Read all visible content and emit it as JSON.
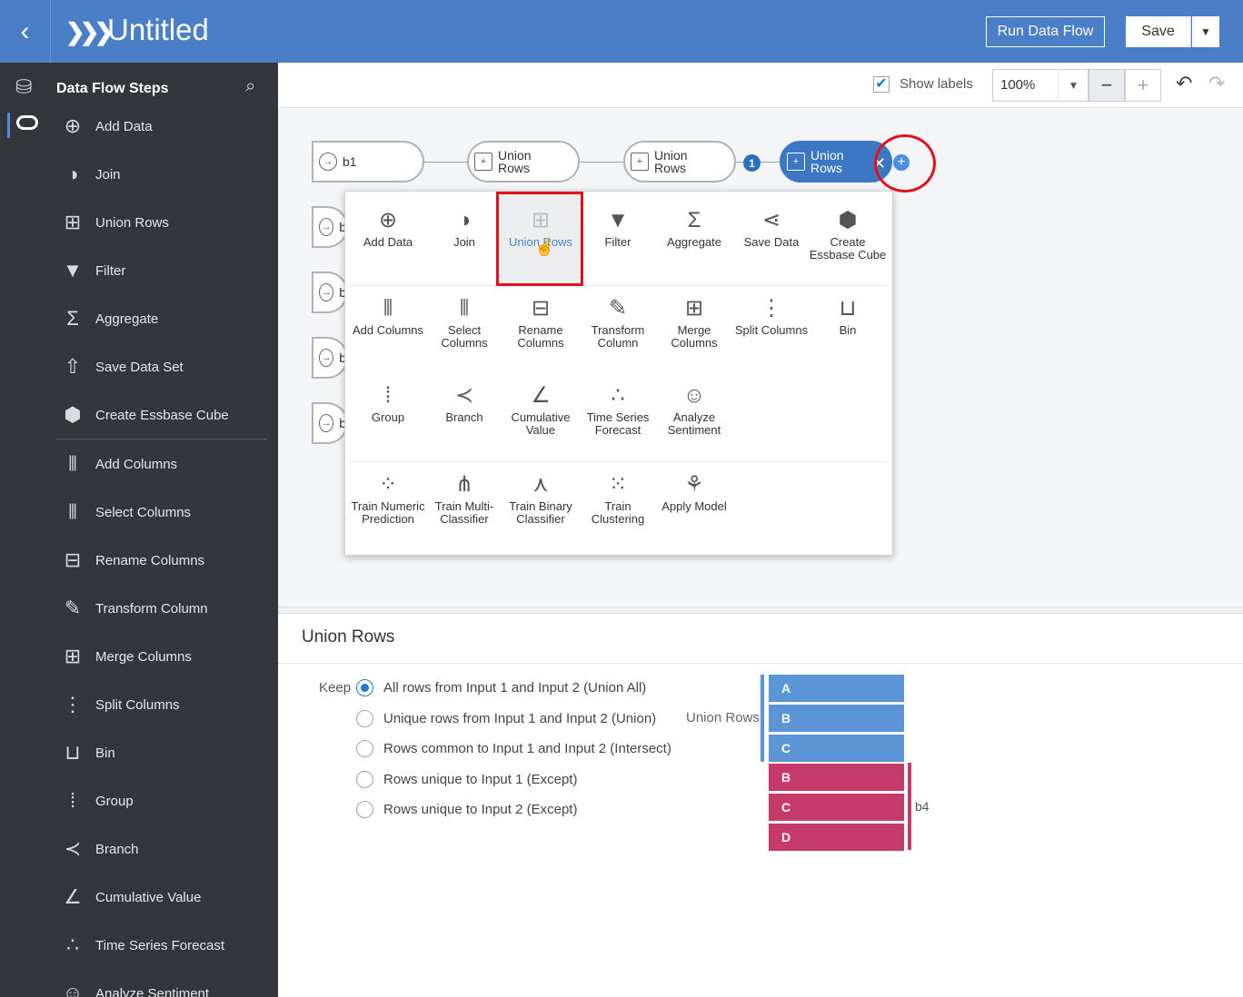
{
  "header": {
    "title": "Untitled",
    "run_label": "Run Data Flow",
    "save_label": "Save"
  },
  "sidebar": {
    "title": "Data Flow Steps",
    "items": [
      {
        "label": "Add Data",
        "icon": "add-data-icon",
        "glyph": "⊕"
      },
      {
        "label": "Join",
        "icon": "join-icon",
        "glyph": "◑"
      },
      {
        "label": "Union Rows",
        "icon": "union-rows-icon",
        "glyph": "⊞"
      },
      {
        "label": "Filter",
        "icon": "filter-icon",
        "glyph": "▼"
      },
      {
        "label": "Aggregate",
        "icon": "aggregate-icon",
        "glyph": "Σ"
      },
      {
        "label": "Save Data Set",
        "icon": "save-data-set-icon",
        "glyph": "⇧"
      },
      {
        "label": "Create Essbase Cube",
        "icon": "cube-icon",
        "glyph": "⬢"
      },
      {
        "label": "Add Columns",
        "icon": "add-columns-icon",
        "glyph": "⫴"
      },
      {
        "label": "Select Columns",
        "icon": "select-columns-icon",
        "glyph": "⫴"
      },
      {
        "label": "Rename Columns",
        "icon": "rename-columns-icon",
        "glyph": "⊟"
      },
      {
        "label": "Transform Column",
        "icon": "transform-column-icon",
        "glyph": "✎"
      },
      {
        "label": "Merge Columns",
        "icon": "merge-columns-icon",
        "glyph": "⊞"
      },
      {
        "label": "Split Columns",
        "icon": "split-columns-icon",
        "glyph": "⋮"
      },
      {
        "label": "Bin",
        "icon": "bin-icon",
        "glyph": "⊔"
      },
      {
        "label": "Group",
        "icon": "group-icon",
        "glyph": "⁞"
      },
      {
        "label": "Branch",
        "icon": "branch-icon",
        "glyph": "≺"
      },
      {
        "label": "Cumulative Value",
        "icon": "cumulative-value-icon",
        "glyph": "∠"
      },
      {
        "label": "Time Series Forecast",
        "icon": "time-series-icon",
        "glyph": "∴"
      },
      {
        "label": "Analyze Sentiment",
        "icon": "sentiment-icon",
        "glyph": "☺"
      }
    ]
  },
  "toolbar": {
    "show_labels": "Show labels",
    "zoom": "100%"
  },
  "canvas": {
    "nodes": [
      {
        "label": "b1"
      },
      {
        "label": "Union Rows"
      },
      {
        "label": "Union Rows"
      },
      {
        "label": "Union Rows"
      }
    ],
    "left_nodes": [
      "b",
      "b",
      "b",
      "b"
    ],
    "badge": "1"
  },
  "popup": {
    "items": [
      {
        "label": "Add Data",
        "icon": "add-data-icon",
        "glyph": "⊕"
      },
      {
        "label": "Join",
        "icon": "join-icon",
        "glyph": "◑"
      },
      {
        "label": "Union Rows",
        "icon": "union-rows-icon",
        "glyph": "⊞"
      },
      {
        "label": "Filter",
        "icon": "filter-icon",
        "glyph": "▼"
      },
      {
        "label": "Aggregate",
        "icon": "aggregate-icon",
        "glyph": "Σ"
      },
      {
        "label": "Save Data",
        "icon": "save-data-icon",
        "glyph": "⋖"
      },
      {
        "label": "Create Essbase Cube",
        "icon": "cube-icon",
        "glyph": "⬢"
      },
      {
        "label": "Add Columns",
        "icon": "add-columns-icon",
        "glyph": "⫴"
      },
      {
        "label": "Select Columns",
        "icon": "select-columns-icon",
        "glyph": "⫴"
      },
      {
        "label": "Rename Columns",
        "icon": "rename-columns-icon",
        "glyph": "⊟"
      },
      {
        "label": "Transform Column",
        "icon": "transform-column-icon",
        "glyph": "✎"
      },
      {
        "label": "Merge Columns",
        "icon": "merge-columns-icon",
        "glyph": "⊞"
      },
      {
        "label": "Split Columns",
        "icon": "split-columns-icon",
        "glyph": "⋮"
      },
      {
        "label": "Bin",
        "icon": "bin-icon",
        "glyph": "⊔"
      },
      {
        "label": "Group",
        "icon": "group-icon",
        "glyph": "⁞"
      },
      {
        "label": "Branch",
        "icon": "branch-icon",
        "glyph": "≺"
      },
      {
        "label": "Cumulative Value",
        "icon": "cumulative-value-icon",
        "glyph": "∠"
      },
      {
        "label": "Time Series Forecast",
        "icon": "time-series-icon",
        "glyph": "∴"
      },
      {
        "label": "Analyze Sentiment",
        "icon": "sentiment-icon",
        "glyph": "☺"
      },
      {
        "label": "Train Numeric Prediction",
        "icon": "train-numeric-icon",
        "glyph": "⁘"
      },
      {
        "label": "Train Multi-Classifier",
        "icon": "train-multi-icon",
        "glyph": "⋔"
      },
      {
        "label": "Train Binary Classifier",
        "icon": "train-binary-icon",
        "glyph": "⋏"
      },
      {
        "label": "Train Clustering",
        "icon": "train-clustering-icon",
        "glyph": "⁙"
      },
      {
        "label": "Apply Model",
        "icon": "apply-model-icon",
        "glyph": "⚘"
      }
    ]
  },
  "panel": {
    "title": "Union Rows",
    "keep_label": "Keep",
    "options": [
      "All rows from Input 1 and Input 2 (Union All)",
      "Unique rows from Input 1 and Input 2 (Union)",
      "Rows common to Input 1 and Input 2 (Intersect)",
      "Rows unique to Input 1 (Except)",
      "Rows unique to Input 2 (Except)"
    ],
    "selected_option": "All rows from Input 1 and Input 2 (Union All)",
    "union_label": "Union Rows",
    "input_label": "b4",
    "union_cells": [
      "A",
      "B",
      "C"
    ],
    "input_cells": [
      "B",
      "C",
      "D"
    ],
    "colors": {
      "union": "#5b95d6",
      "input": "#c53a6a"
    }
  }
}
